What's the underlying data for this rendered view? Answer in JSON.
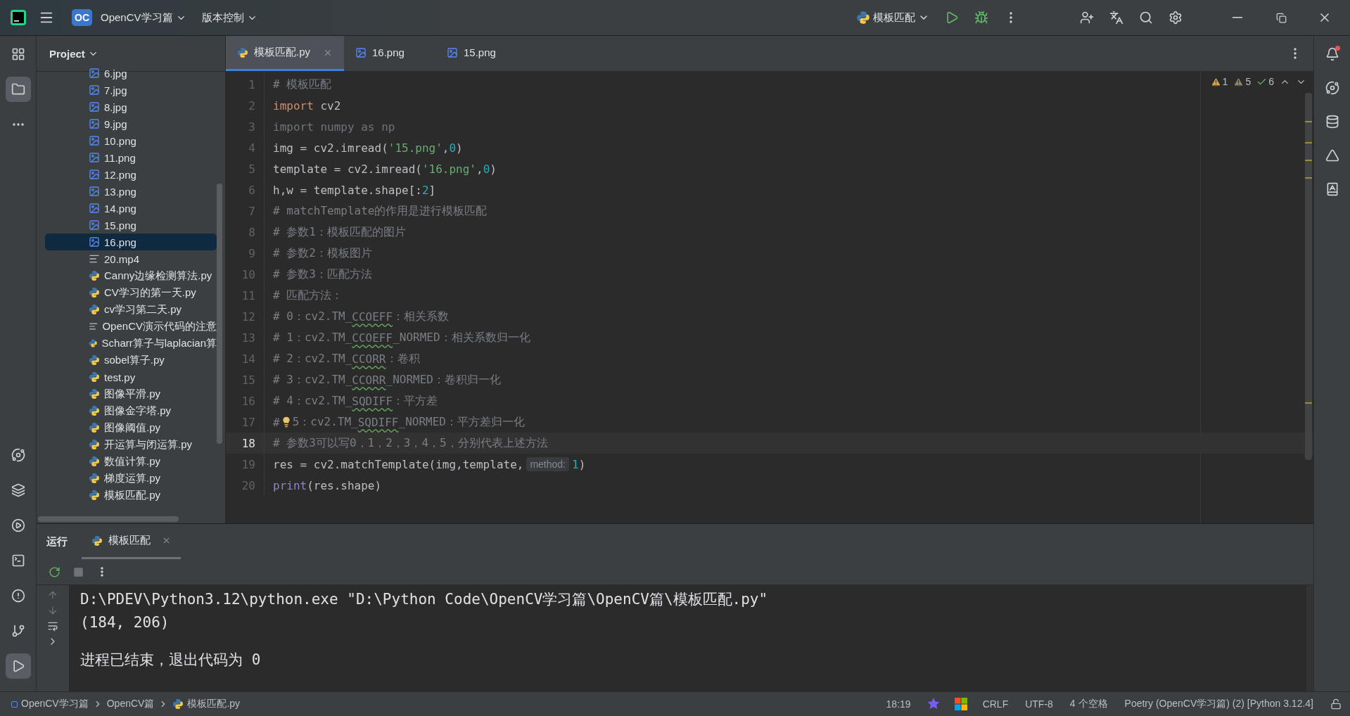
{
  "title_bar": {
    "app_badge": "OC",
    "project": "OpenCV学习篇",
    "vcs": "版本控制",
    "run_config": "模板匹配"
  },
  "project_panel": {
    "title": "Project",
    "items": [
      {
        "name": "6.jpg",
        "kind": "image",
        "selected": false
      },
      {
        "name": "7.jpg",
        "kind": "image",
        "selected": false
      },
      {
        "name": "8.jpg",
        "kind": "image",
        "selected": false
      },
      {
        "name": "9.jpg",
        "kind": "image",
        "selected": false
      },
      {
        "name": "10.png",
        "kind": "image",
        "selected": false
      },
      {
        "name": "11.png",
        "kind": "image",
        "selected": false
      },
      {
        "name": "12.png",
        "kind": "image",
        "selected": false
      },
      {
        "name": "13.png",
        "kind": "image",
        "selected": false
      },
      {
        "name": "14.png",
        "kind": "image",
        "selected": false
      },
      {
        "name": "15.png",
        "kind": "image",
        "selected": false
      },
      {
        "name": "16.png",
        "kind": "image",
        "selected": true
      },
      {
        "name": "20.mp4",
        "kind": "text",
        "selected": false
      },
      {
        "name": "Canny边缘检测算法.py",
        "kind": "python",
        "selected": false
      },
      {
        "name": "CV学习的第一天.py",
        "kind": "python",
        "selected": false
      },
      {
        "name": "cv学习第二天.py",
        "kind": "python",
        "selected": false
      },
      {
        "name": "OpenCV演示代码的注意",
        "kind": "text",
        "selected": false
      },
      {
        "name": "Scharr算子与laplacian算",
        "kind": "python",
        "selected": false
      },
      {
        "name": "sobel算子.py",
        "kind": "python",
        "selected": false
      },
      {
        "name": "test.py",
        "kind": "python",
        "selected": false
      },
      {
        "name": "图像平滑.py",
        "kind": "python",
        "selected": false
      },
      {
        "name": "图像金字塔.py",
        "kind": "python",
        "selected": false
      },
      {
        "name": "图像阈值.py",
        "kind": "python",
        "selected": false
      },
      {
        "name": "开运算与闭运算.py",
        "kind": "python",
        "selected": false
      },
      {
        "name": "数值计算.py",
        "kind": "python",
        "selected": false
      },
      {
        "name": "梯度运算.py",
        "kind": "python",
        "selected": false
      },
      {
        "name": "模板匹配.py",
        "kind": "python",
        "selected": false
      }
    ]
  },
  "editor_tabs": [
    {
      "label": "模板匹配.py",
      "kind": "python",
      "selected": true
    },
    {
      "label": "16.png",
      "kind": "image",
      "selected": false
    },
    {
      "label": "15.png",
      "kind": "image",
      "selected": false
    }
  ],
  "inspections": [
    {
      "kind": "error",
      "count": "1"
    },
    {
      "kind": "warning",
      "count": "5"
    },
    {
      "kind": "typo",
      "count": "6"
    }
  ],
  "code_lines": [
    {
      "number": "1",
      "current": false,
      "intention": false,
      "segments": [
        {
          "kind": "comment",
          "text": "# 模板匹配"
        }
      ]
    },
    {
      "number": "2",
      "current": false,
      "intention": false,
      "segments": [
        {
          "kind": "keyword",
          "text": "import"
        },
        {
          "kind": "plain",
          "text": " cv2"
        }
      ]
    },
    {
      "number": "3",
      "current": false,
      "intention": false,
      "segments": [
        {
          "kind": "unused",
          "text": "import numpy as np"
        }
      ]
    },
    {
      "number": "4",
      "current": false,
      "intention": false,
      "segments": [
        {
          "kind": "plain",
          "text": "img = cv2.imread("
        },
        {
          "kind": "string",
          "text": "'15.png'"
        },
        {
          "kind": "plain",
          "text": ","
        },
        {
          "kind": "number",
          "text": "0"
        },
        {
          "kind": "plain",
          "text": ")"
        }
      ]
    },
    {
      "number": "5",
      "current": false,
      "intention": false,
      "segments": [
        {
          "kind": "plain",
          "text": "template = cv2.imread("
        },
        {
          "kind": "string",
          "text": "'16.png'"
        },
        {
          "kind": "plain",
          "text": ","
        },
        {
          "kind": "number",
          "text": "0"
        },
        {
          "kind": "plain",
          "text": ")"
        }
      ]
    },
    {
      "number": "6",
      "current": false,
      "intention": false,
      "segments": [
        {
          "kind": "plain",
          "text": "h,w = template.shape[:"
        },
        {
          "kind": "number",
          "text": "2"
        },
        {
          "kind": "plain",
          "text": "]"
        }
      ]
    },
    {
      "number": "7",
      "current": false,
      "intention": false,
      "segments": [
        {
          "kind": "comment",
          "text": "# matchTemplate的作用是进行模板匹配"
        }
      ]
    },
    {
      "number": "8",
      "current": false,
      "intention": false,
      "segments": [
        {
          "kind": "comment",
          "text": "# 参数1：模板匹配的图片"
        }
      ]
    },
    {
      "number": "9",
      "current": false,
      "intention": false,
      "segments": [
        {
          "kind": "comment",
          "text": "# 参数2：模板图片"
        }
      ]
    },
    {
      "number": "10",
      "current": false,
      "intention": false,
      "segments": [
        {
          "kind": "comment",
          "text": "# 参数3：匹配方法"
        }
      ]
    },
    {
      "number": "11",
      "current": false,
      "intention": false,
      "segments": [
        {
          "kind": "comment",
          "text": "# 匹配方法："
        }
      ]
    },
    {
      "number": "12",
      "current": false,
      "intention": false,
      "segments": [
        {
          "kind": "comment",
          "text": "# 0：cv2.TM_"
        },
        {
          "kind": "typo",
          "text": "CCOEFF"
        },
        {
          "kind": "comment",
          "text": "：相关系数"
        }
      ]
    },
    {
      "number": "13",
      "current": false,
      "intention": false,
      "segments": [
        {
          "kind": "comment",
          "text": "# 1：cv2.TM_"
        },
        {
          "kind": "typo",
          "text": "CCOEFF"
        },
        {
          "kind": "comment",
          "text": "_NORMED：相关系数归一化"
        }
      ]
    },
    {
      "number": "14",
      "current": false,
      "intention": false,
      "segments": [
        {
          "kind": "comment",
          "text": "# 2：cv2.TM_"
        },
        {
          "kind": "typo",
          "text": "CCORR"
        },
        {
          "kind": "comment",
          "text": "：卷积"
        }
      ]
    },
    {
      "number": "15",
      "current": false,
      "intention": false,
      "segments": [
        {
          "kind": "comment",
          "text": "# 3：cv2.TM_"
        },
        {
          "kind": "typo",
          "text": "CCORR"
        },
        {
          "kind": "comment",
          "text": "_NORMED：卷积归一化"
        }
      ]
    },
    {
      "number": "16",
      "current": false,
      "intention": false,
      "segments": [
        {
          "kind": "comment",
          "text": "# 4：cv2.TM_"
        },
        {
          "kind": "typo",
          "text": "SQDIFF"
        },
        {
          "kind": "comment",
          "text": "：平方差"
        }
      ]
    },
    {
      "number": "17",
      "current": false,
      "intention": true,
      "segments": [
        {
          "kind": "comment",
          "text": "#"
        },
        {
          "kind": "comment",
          "text": "5：cv2.TM_"
        },
        {
          "kind": "typo",
          "text": "SQDIFF"
        },
        {
          "kind": "comment",
          "text": "_NORMED：平方差归一化"
        }
      ]
    },
    {
      "number": "18",
      "current": true,
      "intention": false,
      "segments": [
        {
          "kind": "comment",
          "text": "# 参数3可以写0，1，2，3，4，5，分别代表上述方法"
        }
      ]
    },
    {
      "number": "19",
      "current": false,
      "intention": false,
      "segments": [
        {
          "kind": "plain",
          "text": "res = cv2.matchTemplate(img,template,"
        },
        {
          "kind": "hint",
          "text": "method:"
        },
        {
          "kind": "number",
          "text": "1"
        },
        {
          "kind": "plain",
          "text": ")"
        }
      ]
    },
    {
      "number": "20",
      "current": false,
      "intention": false,
      "segments": [
        {
          "kind": "builtin",
          "text": "print"
        },
        {
          "kind": "plain",
          "text": "(res.shape)"
        }
      ]
    }
  ],
  "run_panel": {
    "label": "运行",
    "tab": "模板匹配",
    "output": [
      "D:\\PDEV\\Python3.12\\python.exe \"D:\\Python Code\\OpenCV学习篇\\OpenCV篇\\模板匹配.py\"",
      "(184, 206)",
      "进程已结束，退出代码为 0"
    ]
  },
  "status_bar": {
    "breadcrumbs": [
      {
        "label": "OpenCV学习篇",
        "kind": "project"
      },
      {
        "label": "OpenCV篇",
        "kind": "folder"
      },
      {
        "label": "模板匹配.py",
        "kind": "python"
      }
    ],
    "position": "18:19",
    "line_endings": "CRLF",
    "encoding": "UTF-8",
    "indent": "4 个空格",
    "interpreter": "Poetry (OpenCV学习篇) (2) [Python 3.12.4]"
  }
}
